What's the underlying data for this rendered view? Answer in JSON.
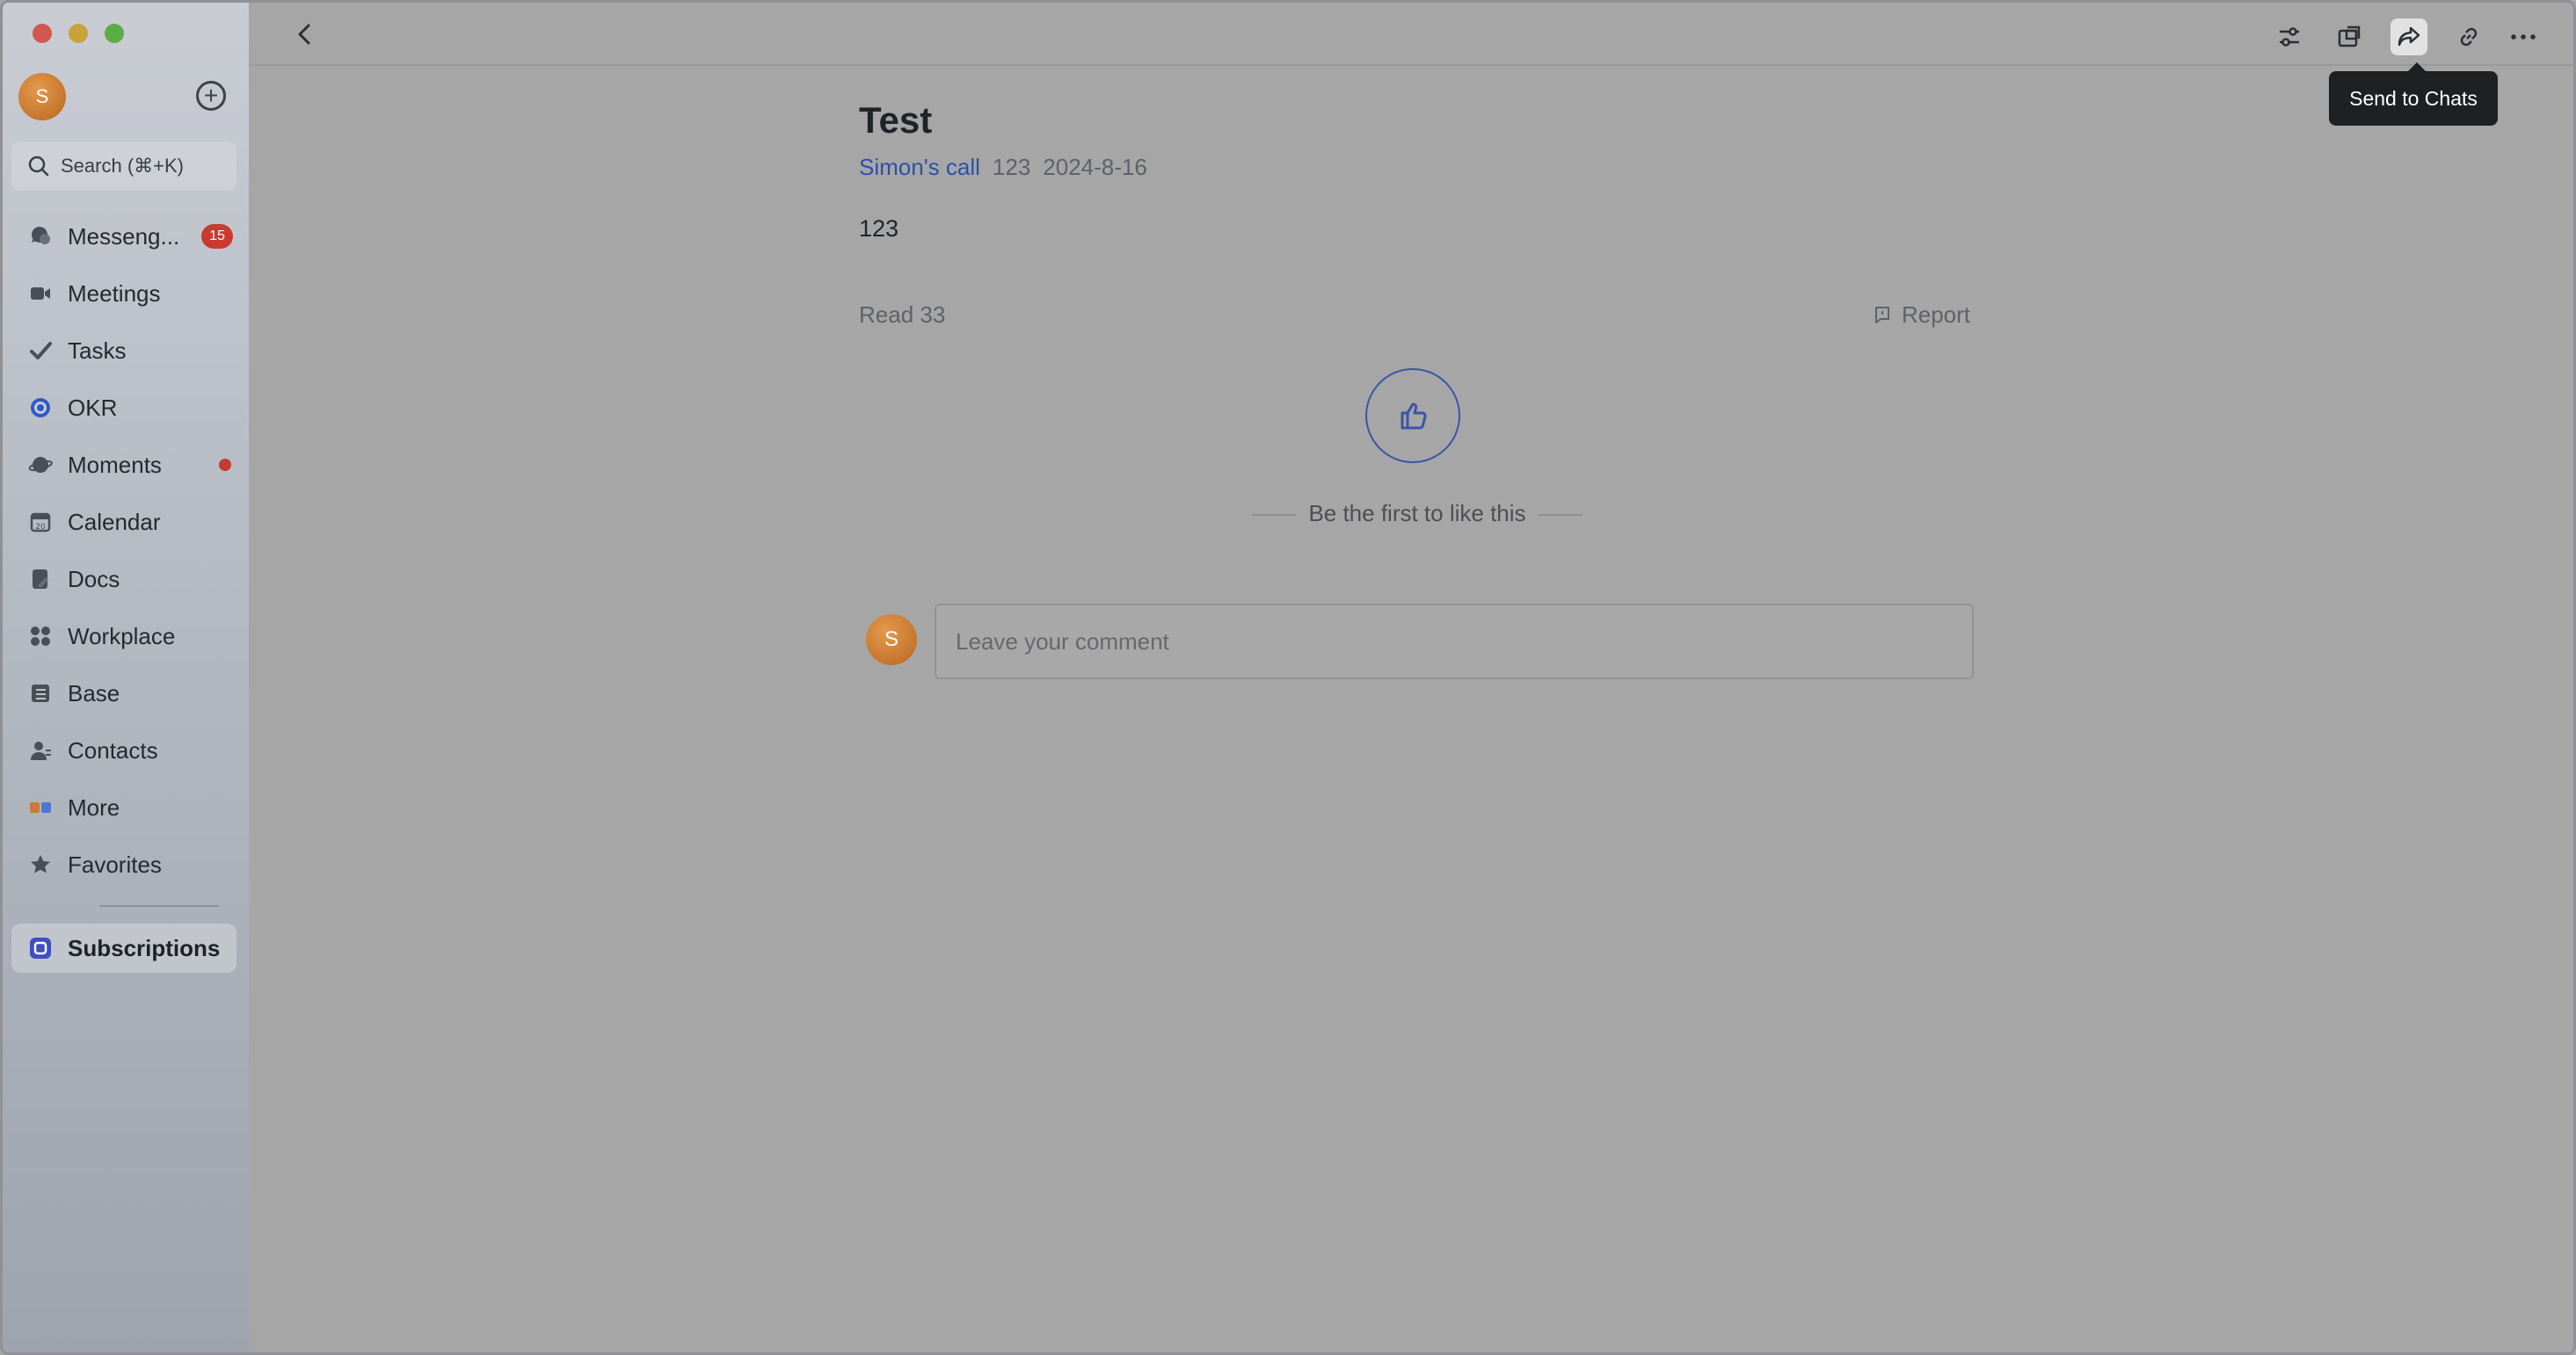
{
  "sidebar": {
    "avatar_initial": "S",
    "search_placeholder": "Search (⌘+K)",
    "items": [
      {
        "label": "Messeng...",
        "icon": "messenger-icon",
        "badge": "15"
      },
      {
        "label": "Meetings",
        "icon": "video-camera-icon"
      },
      {
        "label": "Tasks",
        "icon": "check-icon"
      },
      {
        "label": "OKR",
        "icon": "target-icon"
      },
      {
        "label": "Moments",
        "icon": "planet-icon",
        "dot": true
      },
      {
        "label": "Calendar",
        "icon": "calendar-icon"
      },
      {
        "label": "Docs",
        "icon": "docs-icon"
      },
      {
        "label": "Workplace",
        "icon": "grid-icon"
      },
      {
        "label": "Base",
        "icon": "table-icon"
      },
      {
        "label": "Contacts",
        "icon": "person-icon"
      },
      {
        "label": "More",
        "icon": "apps-icon"
      },
      {
        "label": "Favorites",
        "icon": "star-icon"
      },
      {
        "label": "Subscriptions",
        "icon": "subscriptions-icon",
        "active": true
      }
    ]
  },
  "toolbar": {
    "tooltip": "Send to Chats"
  },
  "post": {
    "title": "Test",
    "author": "Simon's call",
    "meta_number": "123",
    "date": "2024-8-16",
    "body": "123",
    "read": "Read 33",
    "report": "Report",
    "first_like": "Be the first to like this",
    "comment_avatar_initial": "S",
    "comment_placeholder": "Leave your comment"
  },
  "colors": {
    "accent": "#2d4fa8",
    "badge": "#c93b30",
    "avatar": "#d07f33"
  }
}
